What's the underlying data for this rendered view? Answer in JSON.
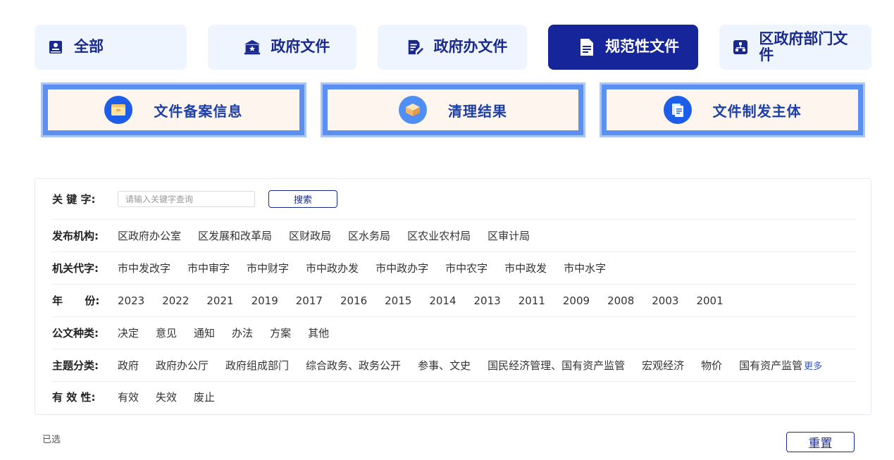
{
  "tabs": [
    {
      "label": "全部",
      "icon": "id-card-icon",
      "active": false
    },
    {
      "label": "政府文件",
      "icon": "government-building-icon",
      "active": false
    },
    {
      "label": "政府办文件",
      "icon": "document-edit-icon",
      "active": false
    },
    {
      "label": "规范性文件",
      "icon": "document-icon",
      "active": true
    },
    {
      "label": "区政府部门文件",
      "icon": "org-chart-icon",
      "active": false
    }
  ],
  "cards": [
    {
      "title": "文件备案信息",
      "icon": "folder-icon"
    },
    {
      "title": "清理结果",
      "icon": "box-icon"
    },
    {
      "title": "文件制发主体",
      "icon": "files-icon"
    }
  ],
  "filters": {
    "keyword": {
      "label": "关 键 字:",
      "placeholder": "请输入关键字查询",
      "value": "",
      "button": "搜索"
    },
    "agency": {
      "label": "发布机构:",
      "options": [
        "区政府办公室",
        "区发展和改革局",
        "区财政局",
        "区水务局",
        "区农业农村局",
        "区审计局"
      ]
    },
    "code": {
      "label": "机关代字:",
      "options": [
        "市中发改字",
        "市中审字",
        "市中财字",
        "市中政办发",
        "市中政办字",
        "市中农字",
        "市中政发",
        "市中水字"
      ]
    },
    "year": {
      "label": "年      份:",
      "options": [
        "2023",
        "2022",
        "2021",
        "2019",
        "2017",
        "2016",
        "2015",
        "2014",
        "2013",
        "2011",
        "2009",
        "2008",
        "2003",
        "2001"
      ]
    },
    "doc_type": {
      "label": "公文种类:",
      "options": [
        "决定",
        "意见",
        "通知",
        "办法",
        "方案",
        "其他"
      ]
    },
    "topic": {
      "label": "主题分类:",
      "options": [
        "政府",
        "政府办公厅",
        "政府组成部门",
        "综合政务、政务公开",
        "参事、文史",
        "国民经济管理、国有资产监管",
        "宏观经济",
        "物价",
        "国有资产监管"
      ],
      "more": "更多"
    },
    "validity": {
      "label": "有 效 性:",
      "options": [
        "有效",
        "失效",
        "废止"
      ]
    }
  },
  "selected_label": "已选",
  "reset_label": "重置",
  "colors": {
    "primary": "#16259a",
    "tab_bg": "#eef5ff",
    "card_border": "#5b90f0",
    "card_bg": "#fdf5ee",
    "card_icon": "#1c5ee8"
  }
}
